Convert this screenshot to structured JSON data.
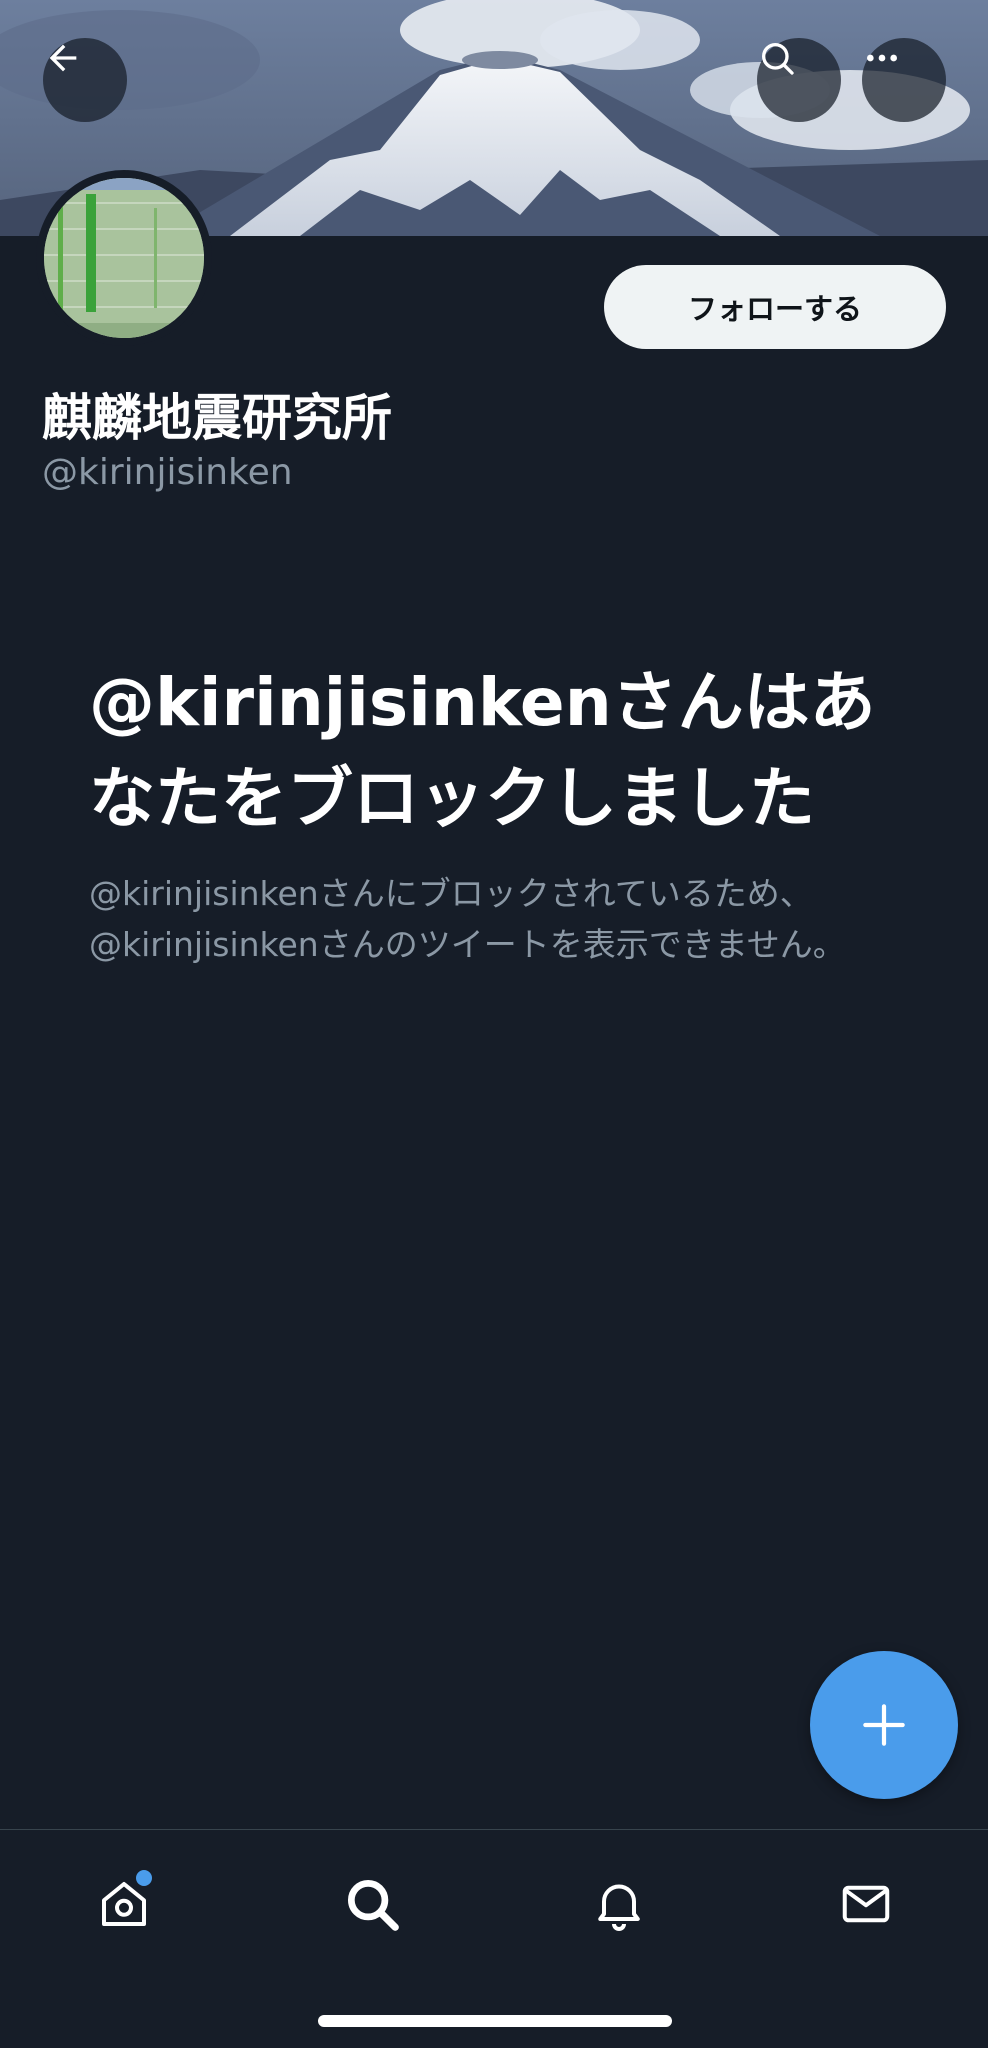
{
  "header": {
    "back_icon": "arrow-left-icon",
    "search_icon": "search-icon",
    "more_icon": "more-horizontal-icon"
  },
  "profile": {
    "display_name": "麒麟地震研究所",
    "handle": "@kirinjisinken",
    "follow_label": "フォローする"
  },
  "blocked": {
    "title": "@kirinjisinkenさんはあなたをブロックしました",
    "description": "@kirinjisinkenさんにブロックされているため、@kirinjisinkenさんのツイートを表示できません。"
  },
  "fab": {
    "icon": "plus-icon"
  },
  "nav": {
    "items": [
      {
        "icon": "home-icon",
        "has_notification_dot": true
      },
      {
        "icon": "search-icon",
        "active": true
      },
      {
        "icon": "bell-icon"
      },
      {
        "icon": "mail-icon"
      }
    ]
  },
  "colors": {
    "background": "#161d28",
    "accent": "#4a9ceb",
    "secondary_text": "#8b98a5",
    "follow_button_bg": "#eff3f4"
  }
}
